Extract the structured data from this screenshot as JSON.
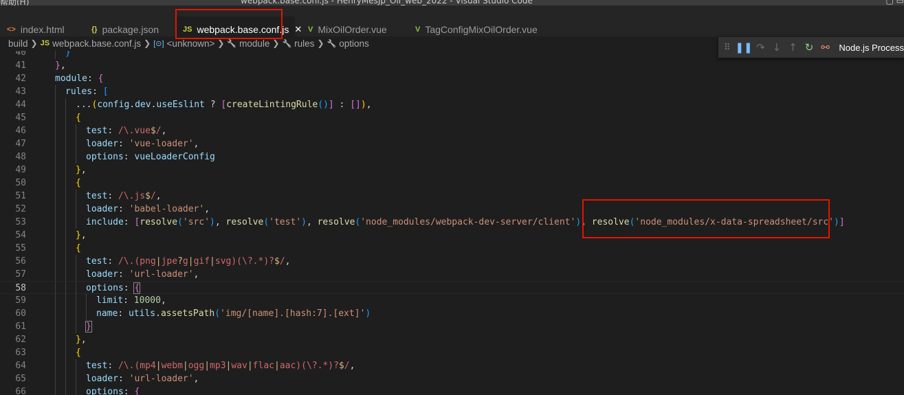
{
  "window": {
    "title": "webpack.base.conf.js - HenryMesJp_Oil_web_2022 - Visual Studio Code",
    "menu_visible": "帮助(H)"
  },
  "tabs": [
    {
      "label": "index.html",
      "icon": "html-file-icon",
      "icon_glyph": "<>",
      "icon_color": "#e37933",
      "active": false
    },
    {
      "label": "package.json",
      "icon": "json-file-icon",
      "icon_glyph": "{}",
      "icon_color": "#cbcb41",
      "active": false
    },
    {
      "label": "webpack.base.conf.js",
      "icon": "js-file-icon",
      "icon_glyph": "JS",
      "icon_color": "#cbcb41",
      "active": true
    },
    {
      "label": "MixOilOrder.vue",
      "icon": "vue-file-icon",
      "icon_glyph": "V",
      "icon_color": "#8dc149",
      "active": false
    },
    {
      "label": "TagConfigMixOilOrder.vue",
      "icon": "vue-file-icon",
      "icon_glyph": "V",
      "icon_color": "#8dc149",
      "active": false
    }
  ],
  "breadcrumb": [
    {
      "label": "build",
      "icon": ""
    },
    {
      "label": "webpack.base.conf.js",
      "icon": "JS"
    },
    {
      "label": "<unknown>",
      "icon": "[⊙]"
    },
    {
      "label": "module",
      "icon": "🔧"
    },
    {
      "label": "rules",
      "icon": "🔧"
    },
    {
      "label": "options",
      "icon": "🔧"
    }
  ],
  "debug_toolbar": {
    "session": "Node.js Process",
    "icons": [
      "drag-grip-icon",
      "pause-icon",
      "step-over-icon",
      "step-into-icon",
      "step-out-icon",
      "restart-icon",
      "disconnect-icon"
    ]
  },
  "colors": {
    "highlight_box": "#e51400",
    "editor_bg": "#1e1e1e",
    "tabbar_bg": "#252526"
  },
  "editor": {
    "current_line": 58,
    "lines": [
      {
        "n": "40",
        "indent": 1,
        "tokens": [
          [
            "}",
            "b3"
          ]
        ]
      },
      {
        "n": "41",
        "indent": 0,
        "tokens": [
          [
            "}",
            "b2"
          ],
          [
            ",",
            "pun"
          ]
        ]
      },
      {
        "n": "42",
        "indent": 0,
        "tokens": [
          [
            "module",
            "key"
          ],
          [
            ": ",
            "pun"
          ],
          [
            "{",
            "b2"
          ]
        ]
      },
      {
        "n": "43",
        "indent": 1,
        "tokens": [
          [
            "rules",
            "key"
          ],
          [
            ": ",
            "pun"
          ],
          [
            "[",
            "b3"
          ]
        ]
      },
      {
        "n": "44",
        "indent": 2,
        "tokens": [
          [
            "...",
            "pun"
          ],
          [
            "(",
            "b1"
          ],
          [
            "config",
            "key"
          ],
          [
            ".",
            "pun"
          ],
          [
            "dev",
            "key"
          ],
          [
            ".",
            "pun"
          ],
          [
            "useEslint",
            "key"
          ],
          [
            " ? ",
            "pun"
          ],
          [
            "[",
            "b2"
          ],
          [
            "createLintingRule",
            "fn"
          ],
          [
            "()",
            "b3"
          ],
          [
            "]",
            "b2"
          ],
          [
            " : ",
            "pun"
          ],
          [
            "[]",
            "b2"
          ],
          [
            ")",
            "b1"
          ],
          [
            ",",
            "pun"
          ]
        ]
      },
      {
        "n": "45",
        "indent": 2,
        "tokens": [
          [
            "{",
            "b1"
          ]
        ]
      },
      {
        "n": "46",
        "indent": 3,
        "tokens": [
          [
            "test",
            "key"
          ],
          [
            ": ",
            "pun"
          ],
          [
            "/\\.",
            "reg"
          ],
          [
            "vue",
            "reg"
          ],
          [
            "$",
            "esc"
          ],
          [
            "/",
            "reg"
          ],
          [
            ",",
            "pun"
          ]
        ]
      },
      {
        "n": "47",
        "indent": 3,
        "tokens": [
          [
            "loader",
            "key"
          ],
          [
            ": ",
            "pun"
          ],
          [
            "'vue-loader'",
            "str"
          ],
          [
            ",",
            "pun"
          ]
        ]
      },
      {
        "n": "48",
        "indent": 3,
        "tokens": [
          [
            "options",
            "key"
          ],
          [
            ": ",
            "pun"
          ],
          [
            "vueLoaderConfig",
            "key"
          ]
        ]
      },
      {
        "n": "49",
        "indent": 2,
        "tokens": [
          [
            "}",
            "b1"
          ],
          [
            ",",
            "pun"
          ]
        ]
      },
      {
        "n": "50",
        "indent": 2,
        "tokens": [
          [
            "{",
            "b1"
          ]
        ]
      },
      {
        "n": "51",
        "indent": 3,
        "tokens": [
          [
            "test",
            "key"
          ],
          [
            ": ",
            "pun"
          ],
          [
            "/\\.",
            "reg"
          ],
          [
            "js",
            "reg"
          ],
          [
            "$",
            "esc"
          ],
          [
            "/",
            "reg"
          ],
          [
            ",",
            "pun"
          ]
        ]
      },
      {
        "n": "52",
        "indent": 3,
        "tokens": [
          [
            "loader",
            "key"
          ],
          [
            ": ",
            "pun"
          ],
          [
            "'babel-loader'",
            "str"
          ],
          [
            ",",
            "pun"
          ]
        ]
      },
      {
        "n": "53",
        "indent": 3,
        "tokens": [
          [
            "include",
            "key"
          ],
          [
            ": ",
            "pun"
          ],
          [
            "[",
            "b2"
          ],
          [
            "resolve",
            "fn"
          ],
          [
            "(",
            "b3"
          ],
          [
            "'src'",
            "str"
          ],
          [
            ")",
            "b3"
          ],
          [
            ", ",
            "pun"
          ],
          [
            "resolve",
            "fn"
          ],
          [
            "(",
            "b3"
          ],
          [
            "'test'",
            "str"
          ],
          [
            ")",
            "b3"
          ],
          [
            ", ",
            "pun"
          ],
          [
            "resolve",
            "fn"
          ],
          [
            "(",
            "b3"
          ],
          [
            "'node_modules/webpack-dev-server/client'",
            "str"
          ],
          [
            ")",
            "b3"
          ],
          [
            ", ",
            "pun"
          ],
          [
            "resolve",
            "fn"
          ],
          [
            "(",
            "b3"
          ],
          [
            "'node_modules/x-data-spreadsheet/src'",
            "str"
          ],
          [
            ")",
            "b3"
          ],
          [
            "]",
            "b2"
          ]
        ]
      },
      {
        "n": "54",
        "indent": 2,
        "tokens": [
          [
            "}",
            "b1"
          ],
          [
            ",",
            "pun"
          ]
        ]
      },
      {
        "n": "55",
        "indent": 2,
        "tokens": [
          [
            "{",
            "b1"
          ]
        ]
      },
      {
        "n": "56",
        "indent": 3,
        "tokens": [
          [
            "test",
            "key"
          ],
          [
            ": ",
            "pun"
          ],
          [
            "/\\.(",
            "reg"
          ],
          [
            "png",
            "reg"
          ],
          [
            "|",
            "esc"
          ],
          [
            "jpe",
            "reg"
          ],
          [
            "?",
            "esc"
          ],
          [
            "g",
            "reg"
          ],
          [
            "|",
            "esc"
          ],
          [
            "gif",
            "reg"
          ],
          [
            "|",
            "esc"
          ],
          [
            "svg",
            "reg"
          ],
          [
            ")(\\?.*)?",
            "reg"
          ],
          [
            "$",
            "esc"
          ],
          [
            "/",
            "reg"
          ],
          [
            ",",
            "pun"
          ]
        ]
      },
      {
        "n": "57",
        "indent": 3,
        "tokens": [
          [
            "loader",
            "key"
          ],
          [
            ": ",
            "pun"
          ],
          [
            "'url-loader'",
            "str"
          ],
          [
            ",",
            "pun"
          ]
        ]
      },
      {
        "n": "58",
        "indent": 3,
        "tokens": [
          [
            "options",
            "key"
          ],
          [
            ": ",
            "pun"
          ],
          [
            "{",
            "b2m"
          ]
        ]
      },
      {
        "n": "59",
        "indent": 4,
        "tokens": [
          [
            "limit",
            "key"
          ],
          [
            ": ",
            "pun"
          ],
          [
            "10000",
            "num"
          ],
          [
            ",",
            "pun"
          ]
        ]
      },
      {
        "n": "60",
        "indent": 4,
        "tokens": [
          [
            "name",
            "key"
          ],
          [
            ": ",
            "pun"
          ],
          [
            "utils",
            "key"
          ],
          [
            ".",
            "pun"
          ],
          [
            "assetsPath",
            "fn"
          ],
          [
            "(",
            "b3"
          ],
          [
            "'img/[name].[hash:7].[ext]'",
            "str"
          ],
          [
            ")",
            "b3"
          ]
        ]
      },
      {
        "n": "61",
        "indent": 3,
        "tokens": [
          [
            "}",
            "b2m"
          ]
        ]
      },
      {
        "n": "62",
        "indent": 2,
        "tokens": [
          [
            "}",
            "b1"
          ],
          [
            ",",
            "pun"
          ]
        ]
      },
      {
        "n": "63",
        "indent": 2,
        "tokens": [
          [
            "{",
            "b1"
          ]
        ]
      },
      {
        "n": "64",
        "indent": 3,
        "tokens": [
          [
            "test",
            "key"
          ],
          [
            ": ",
            "pun"
          ],
          [
            "/\\.(",
            "reg"
          ],
          [
            "mp4",
            "reg"
          ],
          [
            "|",
            "esc"
          ],
          [
            "webm",
            "reg"
          ],
          [
            "|",
            "esc"
          ],
          [
            "ogg",
            "reg"
          ],
          [
            "|",
            "esc"
          ],
          [
            "mp3",
            "reg"
          ],
          [
            "|",
            "esc"
          ],
          [
            "wav",
            "reg"
          ],
          [
            "|",
            "esc"
          ],
          [
            "flac",
            "reg"
          ],
          [
            "|",
            "esc"
          ],
          [
            "aac",
            "reg"
          ],
          [
            ")(\\?.*)?",
            "reg"
          ],
          [
            "$",
            "esc"
          ],
          [
            "/",
            "reg"
          ],
          [
            ",",
            "pun"
          ]
        ]
      },
      {
        "n": "65",
        "indent": 3,
        "tokens": [
          [
            "loader",
            "key"
          ],
          [
            ": ",
            "pun"
          ],
          [
            "'url-loader'",
            "str"
          ],
          [
            ",",
            "pun"
          ]
        ]
      },
      {
        "n": "66",
        "indent": 3,
        "tokens": [
          [
            "options",
            "key"
          ],
          [
            ": ",
            "pun"
          ],
          [
            "{",
            "b2"
          ]
        ]
      }
    ]
  }
}
